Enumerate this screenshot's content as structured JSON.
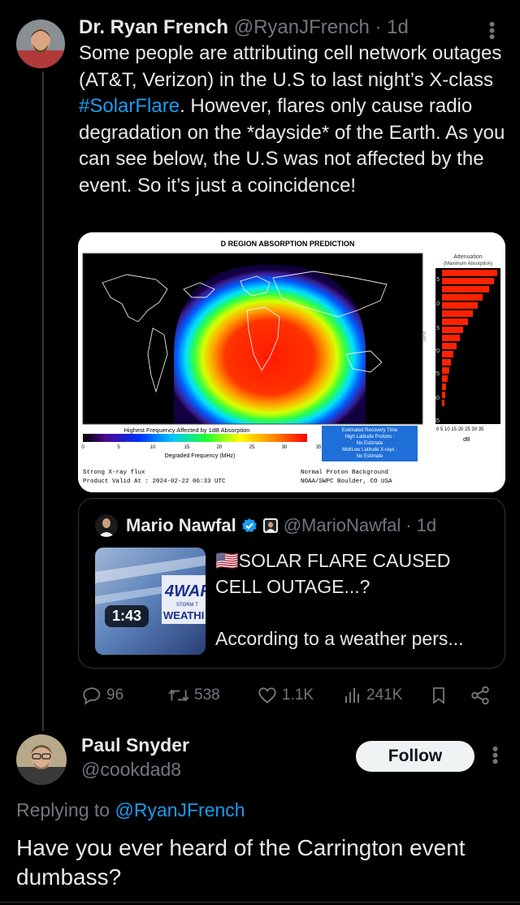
{
  "tweet": {
    "author_name": "Dr. Ryan French",
    "author_handle": "@RyanJFrench",
    "time": "1d",
    "text_before": "Some people are attributing cell network outages (AT&T, Verizon) in the U.S to last night’s X-class ",
    "hashtag": "#SolarFlare",
    "text_after": ". However, flares only cause radio degradation on the *dayside* of the Earth. As you can see below, the U.S was not affected by the event. So it’s just a coincidence!",
    "image": {
      "title": "D REGION ABSORPTION PREDICTION",
      "attenuation_label_1": "Attenuation",
      "attenuation_label_2": "(Maximum Absorption)",
      "mhz_label": "MHz",
      "db_label": "dB",
      "mhz_ticks": [
        "5",
        "10",
        "15",
        "20",
        "25",
        "30",
        "35"
      ],
      "db_ticks": "0  5  10 15 20 25 30 35",
      "colorbar_title": "Highest Frequency Affected by 1dB Absorption",
      "colorbar_ticks": [
        "0",
        "5",
        "10",
        "15",
        "20",
        "25",
        "30",
        "35"
      ],
      "colorbar_xlabel": "Degraded Frequency (MHz)",
      "recovery_1": "Estimated Recovery Time",
      "recovery_2": "High Latitude Protons :",
      "recovery_3": "No Estimate",
      "recovery_4": "Mid/Low Latitude X-rays :",
      "recovery_5": "No Estimate",
      "flux_line": "Strong X-ray flux",
      "valid_line": "Product Valid At : 2024-02-22 06:33 UTC",
      "proton_line": "Normal Proton Background",
      "source_line": "NOAA/SWPC Boulder, CO USA"
    },
    "actions": {
      "replies": "96",
      "retweets": "538",
      "likes": "1.1K",
      "views": "241K"
    }
  },
  "quote": {
    "author_name": "Mario Nawfal",
    "author_handle": "@MarioNawfal",
    "time": "1d",
    "title": "🇺🇸SOLAR FLARE CAUSED CELL OUTAGE...?",
    "snippet": "According to a weather pers...",
    "video_duration": "1:43",
    "thumb_text_1": "4WAF",
    "thumb_text_2": "STORM T",
    "thumb_text_3": "WEATHI"
  },
  "reply": {
    "author_name": "Paul Snyder",
    "author_handle": "@cookdad8",
    "follow_label": "Follow",
    "replying_prefix": "Replying to ",
    "replying_to": "@RyanJFrench",
    "text": "Have you ever heard of the Carrington event dumbass?"
  },
  "colors": {
    "background": "#000000",
    "text": "#e7e9ea",
    "secondary": "#71767b",
    "accent": "#1d9bf0"
  }
}
